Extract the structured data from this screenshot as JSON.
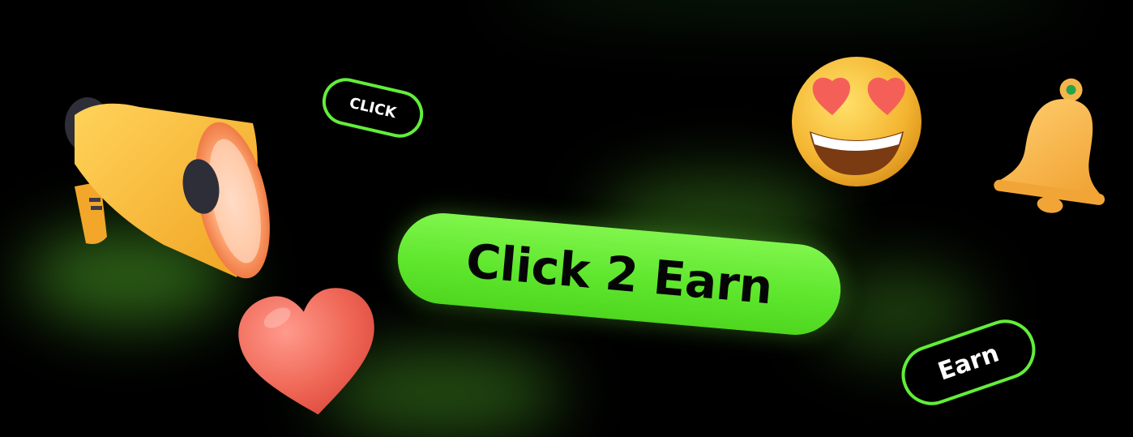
{
  "cta": {
    "label": "Click 2 Earn",
    "color": "#5fe72e"
  },
  "pills": {
    "click_label": "CLICK",
    "earn_label": "Earn",
    "outline_color": "#62ee3a"
  },
  "decorations": {
    "icons": [
      "megaphone-icon",
      "heart-icon",
      "heart-eyes-emoji-icon",
      "bell-icon"
    ]
  },
  "colors": {
    "background": "#000000",
    "accent": "#62ee3a",
    "glow": "#4eaa28"
  }
}
